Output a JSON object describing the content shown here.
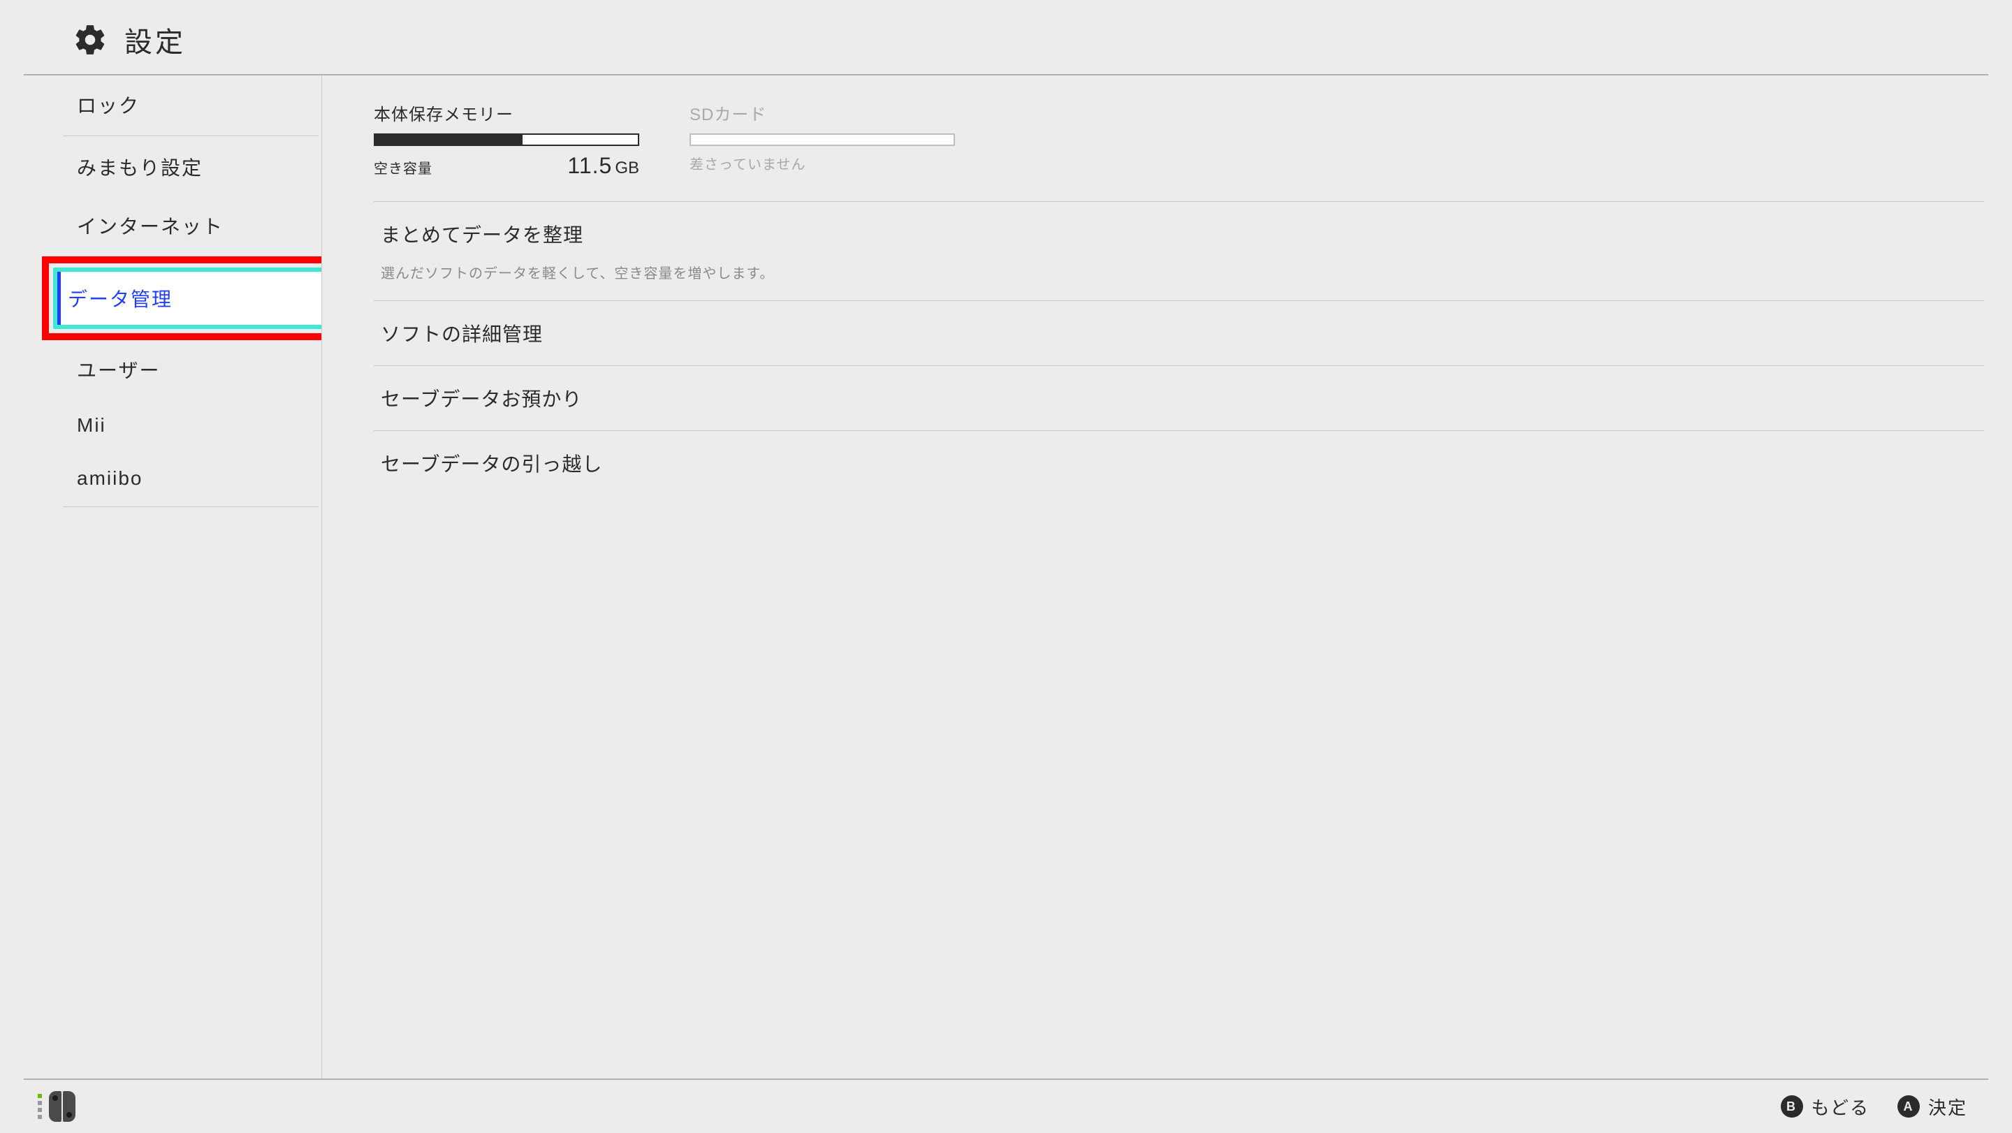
{
  "header": {
    "title": "設定"
  },
  "sidebar": {
    "items": {
      "lock": "ロック",
      "parental": "みまもり設定",
      "internet": "インターネット",
      "data": "データ管理",
      "user": "ユーザー",
      "mii": "Mii",
      "amiibo": "amiibo"
    },
    "selected": "data"
  },
  "storage": {
    "internal": {
      "title": "本体保存メモリー",
      "free_label": "空き容量",
      "free_value": "11.5",
      "free_unit": "GB",
      "fill_percent": 56
    },
    "sd": {
      "title": "SDカード",
      "not_inserted": "差さっていません"
    }
  },
  "options": {
    "organize": {
      "title": "まとめてデータを整理",
      "desc": "選んだソフトのデータを軽くして、空き容量を増やします。"
    },
    "software_detail": {
      "title": "ソフトの詳細管理"
    },
    "save_cloud": {
      "title": "セーブデータお預かり"
    },
    "save_transfer": {
      "title": "セーブデータの引っ越し"
    }
  },
  "footer": {
    "back_letter": "B",
    "back_label": "もどる",
    "ok_letter": "A",
    "ok_label": "決定"
  }
}
